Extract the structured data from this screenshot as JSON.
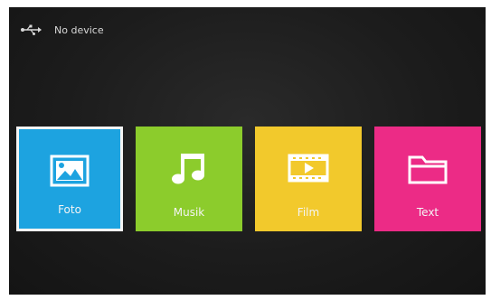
{
  "status": {
    "icon": "usb-icon",
    "text": "No device"
  },
  "tiles": [
    {
      "label": "Foto",
      "icon": "image-icon",
      "color": "#1da3e0",
      "selected": true
    },
    {
      "label": "Musik",
      "icon": "music-note-icon",
      "color": "#8ccc2c",
      "selected": false
    },
    {
      "label": "Film",
      "icon": "film-icon",
      "color": "#f2c92c",
      "selected": false
    },
    {
      "label": "Text",
      "icon": "folder-icon",
      "color": "#ec2b86",
      "selected": false
    }
  ]
}
